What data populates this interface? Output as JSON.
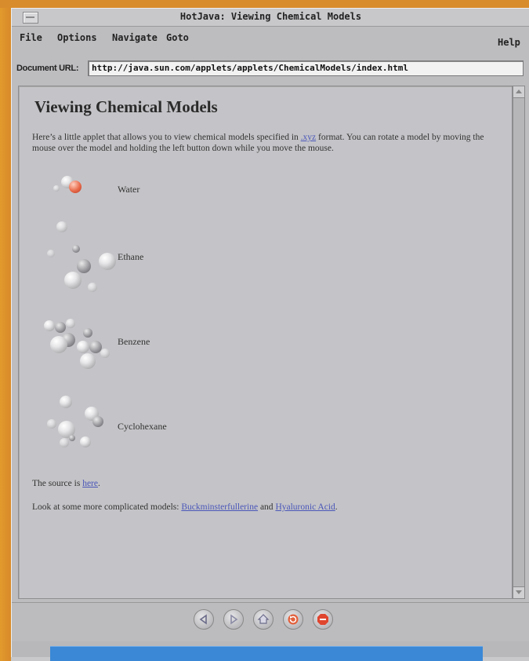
{
  "window": {
    "title": "HotJava: Viewing Chemical Models"
  },
  "menubar": {
    "file": "File",
    "options": "Options",
    "navigate": "Navigate",
    "goto": "Goto",
    "help": "Help"
  },
  "url": {
    "label": "Document URL:",
    "value": "http://java.sun.com/applets/applets/ChemicalModels/index.html"
  },
  "page": {
    "heading": "Viewing Chemical Models",
    "intro_before": "Here’s a little applet that allows you to view chemical models specified in ",
    "intro_link": ".xyz",
    "intro_after": " format. You can rotate a model by moving the mouse over the model and holding the left button down while you move the mouse.",
    "molecules": [
      "Water",
      "Ethane",
      "Benzene",
      "Cyclohexane"
    ],
    "source_before": "The source is ",
    "source_link": "here",
    "source_after": ".",
    "more_before": "Look at some more complicated models: ",
    "more_link1": "Buckminsterfullerine",
    "more_mid": " and ",
    "more_link2": "Hyaluronic Acid",
    "more_after": "."
  },
  "nav": [
    "back-icon",
    "forward-icon",
    "home-icon",
    "reload-icon",
    "stop-icon"
  ],
  "colors": {
    "link": "#4a56b8",
    "oxygen": "#e86a4a",
    "background": "#c4c4c8"
  }
}
